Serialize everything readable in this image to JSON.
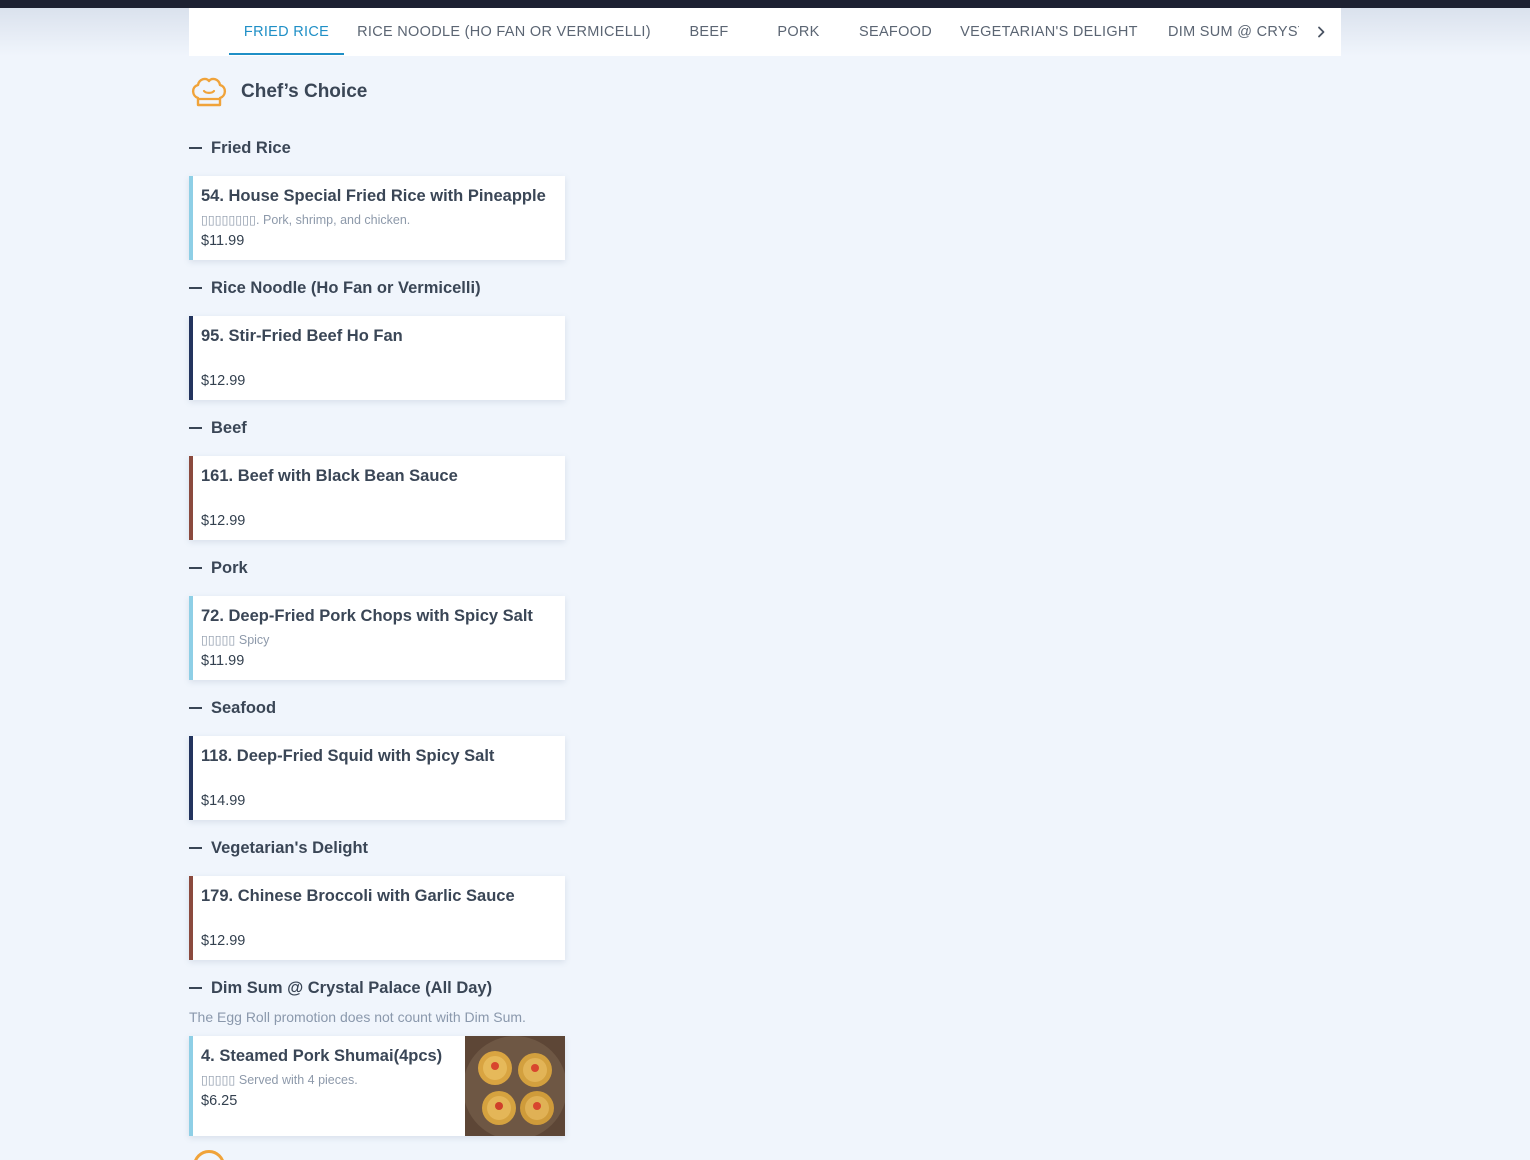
{
  "nav": {
    "tabs": [
      {
        "label": "FRIED RICE",
        "active": true
      },
      {
        "label": "RICE NOODLE (HO FAN OR VERMICELLI)",
        "active": false
      },
      {
        "label": "BEEF",
        "active": false
      },
      {
        "label": "PORK",
        "active": false
      },
      {
        "label": "SEAFOOD",
        "active": false
      },
      {
        "label": "VEGETARIAN'S DELIGHT",
        "active": false
      },
      {
        "label": "DIM SUM @ CRYSTAL PALACE (ALL DAY)",
        "active": false
      }
    ],
    "next_icon": "chevron-right-icon",
    "active_color": "#1f8fc6"
  },
  "section": {
    "title": "Chef’s Choice",
    "icon": "chef-hat-icon",
    "icon_color": "#f0a33a"
  },
  "categories": [
    {
      "title": "Fried Rice",
      "items": [
        {
          "name": "54. House Special Fried Rice with Pineapple",
          "desc": "▯▯▯▯▯▯▯▯. Pork, shrimp, and chicken.",
          "price": "$11.99",
          "accent": "#8ecfe6"
        }
      ]
    },
    {
      "title": "Rice Noodle (Ho Fan or Vermicelli)",
      "items": [
        {
          "name": "95. Stir-Fried Beef Ho Fan",
          "desc": "",
          "price": "$12.99",
          "accent": "#23345e"
        }
      ]
    },
    {
      "title": "Beef",
      "items": [
        {
          "name": "161. Beef with Black Bean Sauce",
          "desc": "",
          "price": "$12.99",
          "accent": "#8b4a3e"
        }
      ]
    },
    {
      "title": "Pork",
      "items": [
        {
          "name": "72. Deep-Fried Pork Chops with Spicy Salt",
          "desc": "▯▯▯▯▯ Spicy",
          "price": "$11.99",
          "accent": "#8ecfe6"
        }
      ]
    },
    {
      "title": "Seafood",
      "items": [
        {
          "name": "118. Deep-Fried Squid with Spicy Salt",
          "desc": "",
          "price": "$14.99",
          "accent": "#23345e"
        }
      ]
    },
    {
      "title": "Vegetarian's Delight",
      "items": [
        {
          "name": "179. Chinese Broccoli with Garlic Sauce",
          "desc": "",
          "price": "$12.99",
          "accent": "#8b4a3e"
        }
      ]
    },
    {
      "title": "Dim Sum @ Crystal Palace (All Day)",
      "note": "The Egg Roll promotion does not count with Dim Sum.",
      "items": [
        {
          "name": "4. Steamed Pork Shumai(4pcs)",
          "desc": "▯▯▯▯▯ Served with 4 pieces.",
          "price": "$6.25",
          "accent": "#8ecfe6",
          "image": "shumai-photo"
        }
      ]
    }
  ]
}
